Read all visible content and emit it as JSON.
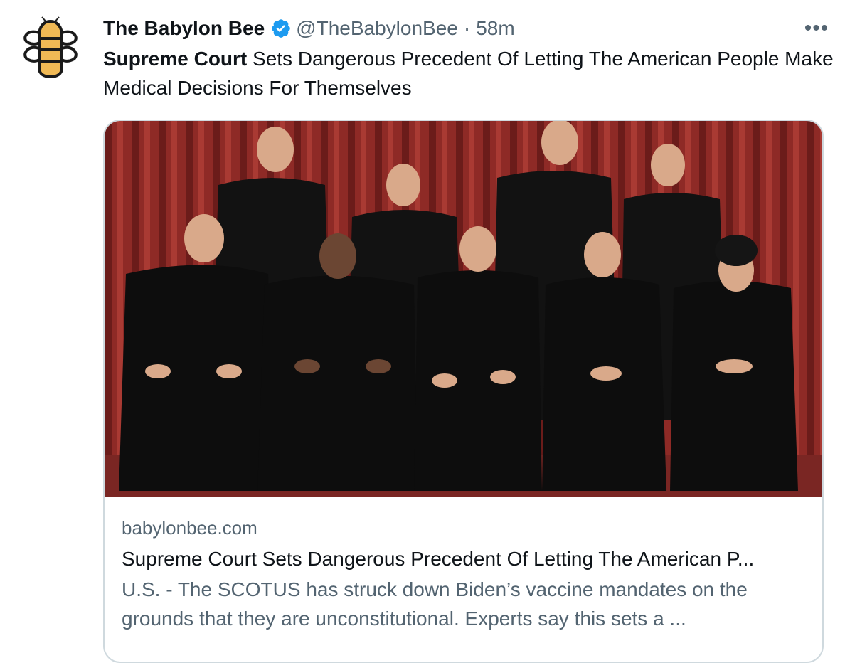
{
  "author": {
    "name": "The Babylon Bee",
    "handle": "@TheBabylonBee",
    "separator": "·",
    "time": "58m",
    "verified_icon": "verified-badge-icon",
    "avatar_icon": "babylon-bee-logo-icon"
  },
  "tweet": {
    "bold_lead": "Supreme Court",
    "rest": " Sets Dangerous Precedent Of Letting The American People Make Medical Decisions For Themselves"
  },
  "more_label": "•••",
  "card": {
    "domain": "babylonbee.com",
    "title": "Supreme Court Sets Dangerous Precedent Of Letting The American P...",
    "description": "U.S. - The SCOTUS has struck down Biden’s vaccine mandates on the grounds that they are unconstitutional. Experts say this sets a ..."
  },
  "colors": {
    "text_primary": "#0f1419",
    "text_secondary": "#536471",
    "verified_blue": "#1d9bf0",
    "border": "#cfd9de",
    "curtain": "#8e2a26",
    "robe": "#141414",
    "logo_gold": "#f0b955"
  }
}
